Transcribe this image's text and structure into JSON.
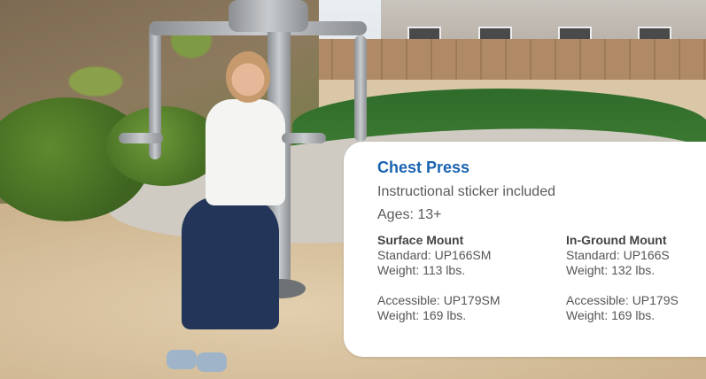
{
  "card": {
    "title": "Chest Press",
    "subtitle": "Instructional sticker included",
    "ages": "Ages: 13+",
    "surface_mount": {
      "heading": "Surface Mount",
      "standard": "Standard: UP166SM",
      "standard_weight": "Weight: 113 lbs.",
      "accessible": "Accessible: UP179SM",
      "accessible_weight": "Weight: 169 lbs."
    },
    "in_ground_mount": {
      "heading": "In-Ground Mount",
      "standard": "Standard: UP166S",
      "standard_weight": "Weight: 132 lbs.",
      "accessible": "Accessible: UP179S",
      "accessible_weight": "Weight: 169 lbs."
    }
  },
  "colors": {
    "title_blue": "#1a63b0",
    "card_bg": "#ffffff"
  }
}
